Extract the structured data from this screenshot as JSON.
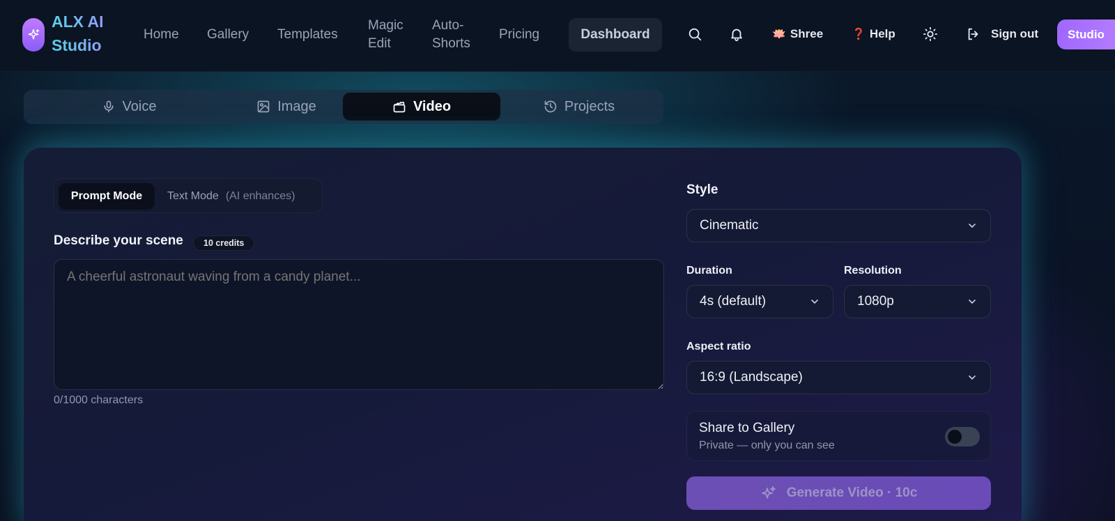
{
  "brand": {
    "line1": "ALX AI",
    "line2": "Studio"
  },
  "nav": {
    "home": "Home",
    "gallery": "Gallery",
    "templates": "Templates",
    "magic_edit_1": "Magic",
    "magic_edit_2": "Edit",
    "auto_shorts_1": "Auto-",
    "auto_shorts_2": "Shorts",
    "pricing": "Pricing",
    "dashboard": "Dashboard",
    "user": "Shree",
    "user_icon": "🪷",
    "help": "Help",
    "help_icon": "❓",
    "sign_out": "Sign out",
    "studio": "Studio"
  },
  "tabs": [
    "Voice",
    "Image",
    "Video",
    "Projects"
  ],
  "modes": {
    "prompt": "Prompt Mode",
    "text": "Text Mode",
    "text_sub": "(AI enhances)"
  },
  "scene": {
    "label": "Describe your scene",
    "credits": "10 credits",
    "placeholder": "A cheerful astronaut waving from a candy planet...",
    "char_count": "0/1000 characters"
  },
  "style": {
    "label": "Style",
    "value": "Cinematic"
  },
  "duration": {
    "label": "Duration",
    "value": "4s (default)"
  },
  "resolution": {
    "label": "Resolution",
    "value": "1080p"
  },
  "aspect": {
    "label": "Aspect ratio",
    "value": "16:9 (Landscape)"
  },
  "share": {
    "title": "Share to Gallery",
    "subtitle": "Private — only you can see",
    "enabled": false
  },
  "generate": {
    "label": "Generate Video · 10c"
  },
  "colors": {
    "accent": "#a067ff",
    "brand_gradient_start": "#5ad1e6",
    "brand_gradient_end": "#a58bff"
  }
}
